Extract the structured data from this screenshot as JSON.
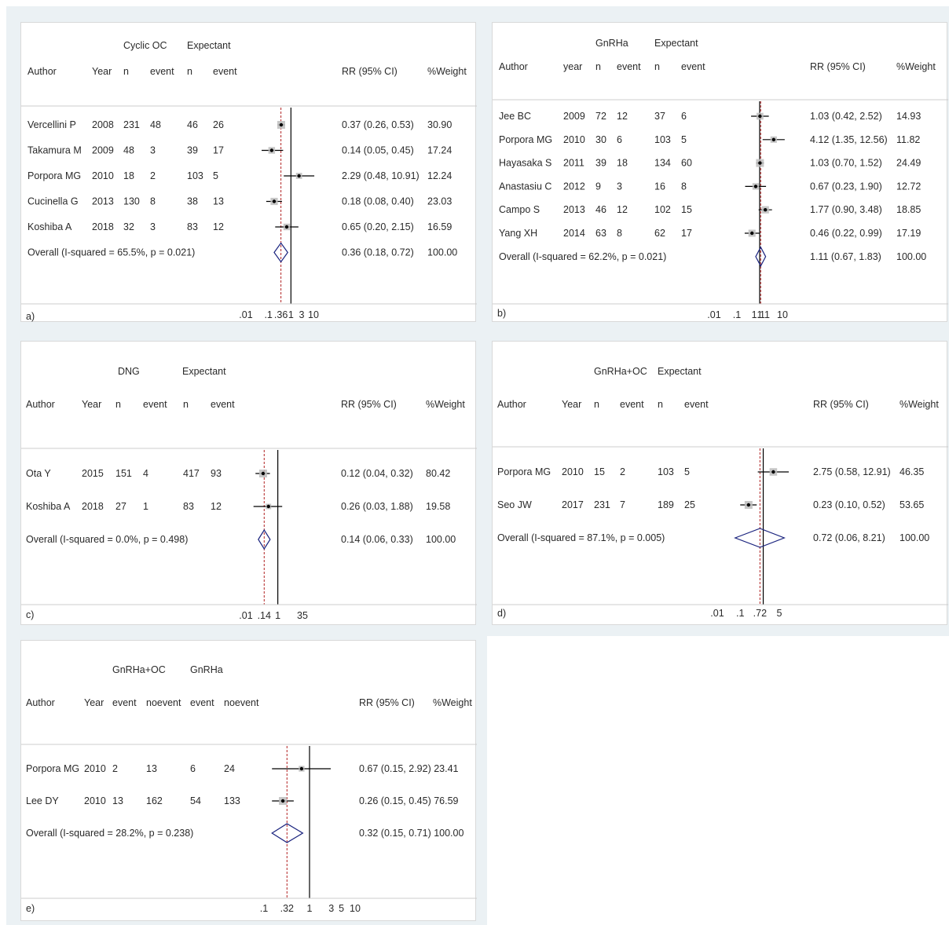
{
  "colors": {
    "background": "#ebf1f4",
    "diamond": "#1a237e",
    "overall_line": "#b22222",
    "null_line": "#000000",
    "marker_box": "#bdbdbd"
  },
  "chart_data": [
    {
      "type": "forest",
      "panel_label": "a)",
      "group_labels": [
        "Cyclic OC",
        "Expectant"
      ],
      "columns": [
        "Author",
        "Year",
        "n",
        "event",
        "n",
        "event",
        "RR (95% CI)",
        "%Weight"
      ],
      "rows": [
        {
          "cells": [
            "Vercellini P",
            "2008",
            "231",
            "48",
            "46",
            "26"
          ],
          "ci_label": "0.37 (0.26, 0.53)",
          "weight_label": "30.90",
          "rr": 0.37,
          "lo": 0.26,
          "hi": 0.53,
          "weight": 30.9
        },
        {
          "cells": [
            "Takamura M",
            "2009",
            "48",
            "3",
            "39",
            "17"
          ],
          "ci_label": "0.14 (0.05, 0.45)",
          "weight_label": "17.24",
          "rr": 0.14,
          "lo": 0.05,
          "hi": 0.45,
          "weight": 17.24
        },
        {
          "cells": [
            "Porpora MG",
            "2010",
            "18",
            "2",
            "103",
            "5"
          ],
          "ci_label": "2.29 (0.48, 10.91)",
          "weight_label": "12.24",
          "rr": 2.29,
          "lo": 0.48,
          "hi": 10.91,
          "weight": 12.24
        },
        {
          "cells": [
            "Cucinella G",
            "2013",
            "130",
            "8",
            "38",
            "13"
          ],
          "ci_label": "0.18 (0.08, 0.40)",
          "weight_label": "23.03",
          "rr": 0.18,
          "lo": 0.08,
          "hi": 0.4,
          "weight": 23.03
        },
        {
          "cells": [
            "Koshiba A",
            "2018",
            "32",
            "3",
            "83",
            "12"
          ],
          "ci_label": "0.65 (0.20, 2.15)",
          "weight_label": "16.59",
          "rr": 0.65,
          "lo": 0.2,
          "hi": 2.15,
          "weight": 16.59
        }
      ],
      "overall": {
        "label": "Overall  (I-squared = 65.5%, p = 0.021)",
        "ci_label": "0.36 (0.18, 0.72)",
        "weight_label": "100.00",
        "rr": 0.36,
        "lo": 0.18,
        "hi": 0.72
      },
      "x_scale": "log",
      "xlim": [
        0.01,
        10
      ],
      "ticks": [
        {
          "value": 0.01,
          "label": ".01"
        },
        {
          "value": 0.1,
          "label": ".1"
        },
        {
          "value": 0.36,
          "label": ".36"
        },
        {
          "value": 1,
          "label": "1"
        },
        {
          "value": 3,
          "label": "3"
        },
        {
          "value": 10,
          "label": "10"
        }
      ]
    },
    {
      "type": "forest",
      "panel_label": "b)",
      "group_labels": [
        "GnRHa",
        "Expectant"
      ],
      "columns": [
        "Author",
        "year",
        "n",
        "event",
        "n",
        "event",
        "RR (95% CI)",
        "%Weight"
      ],
      "rows": [
        {
          "cells": [
            "Jee BC",
            "2009",
            "72",
            "12",
            "37",
            "6"
          ],
          "ci_label": "1.03 (0.42, 2.52)",
          "weight_label": "14.93",
          "rr": 1.03,
          "lo": 0.42,
          "hi": 2.52,
          "weight": 14.93
        },
        {
          "cells": [
            "Porpora MG",
            "2010",
            "30",
            "6",
            "103",
            "5"
          ],
          "ci_label": "4.12 (1.35, 12.56)",
          "weight_label": "11.82",
          "rr": 4.12,
          "lo": 1.35,
          "hi": 12.56,
          "weight": 11.82
        },
        {
          "cells": [
            "Hayasaka S",
            "2011",
            "39",
            "18",
            "134",
            "60"
          ],
          "ci_label": "1.03 (0.70, 1.52)",
          "weight_label": "24.49",
          "rr": 1.03,
          "lo": 0.7,
          "hi": 1.52,
          "weight": 24.49
        },
        {
          "cells": [
            "Anastasiu C",
            "2012",
            "9",
            "3",
            "16",
            "8"
          ],
          "ci_label": "0.67 (0.23, 1.90)",
          "weight_label": "12.72",
          "rr": 0.67,
          "lo": 0.23,
          "hi": 1.9,
          "weight": 12.72
        },
        {
          "cells": [
            "Campo S",
            "2013",
            "46",
            "12",
            "102",
            "15"
          ],
          "ci_label": "1.77 (0.90, 3.48)",
          "weight_label": "18.85",
          "rr": 1.77,
          "lo": 0.9,
          "hi": 3.48,
          "weight": 18.85
        },
        {
          "cells": [
            "Yang XH",
            "2014",
            "63",
            "8",
            "62",
            "17"
          ],
          "ci_label": "0.46 (0.22, 0.99)",
          "weight_label": "17.19",
          "rr": 0.46,
          "lo": 0.22,
          "hi": 0.99,
          "weight": 17.19
        }
      ],
      "overall": {
        "label": "Overall  (I-squared = 62.2%, p = 0.021)",
        "ci_label": "1.11 (0.67, 1.83)",
        "weight_label": "100.00",
        "rr": 1.11,
        "lo": 0.67,
        "hi": 1.83
      },
      "x_scale": "log",
      "xlim": [
        0.01,
        10
      ],
      "ticks": [
        {
          "value": 0.01,
          "label": ".01"
        },
        {
          "value": 0.1,
          "label": ".1"
        },
        {
          "value": 1,
          "label": "1"
        },
        {
          "value": 1.11,
          "label": "1.11"
        },
        {
          "value": 10,
          "label": "10"
        }
      ]
    },
    {
      "type": "forest",
      "panel_label": "c)",
      "group_labels": [
        "DNG",
        "Expectant"
      ],
      "columns": [
        "Author",
        "Year",
        "n",
        "event",
        "n",
        "event",
        "RR (95% CI)",
        "%Weight"
      ],
      "rows": [
        {
          "cells": [
            "Ota Y",
            "2015",
            "151",
            "4",
            "417",
            "93"
          ],
          "ci_label": "0.12 (0.04, 0.32)",
          "weight_label": "80.42",
          "rr": 0.12,
          "lo": 0.04,
          "hi": 0.32,
          "weight": 80.42
        },
        {
          "cells": [
            "Koshiba A",
            "2018",
            "27",
            "1",
            "83",
            "12"
          ],
          "ci_label": "0.26 (0.03, 1.88)",
          "weight_label": "19.58",
          "rr": 0.26,
          "lo": 0.03,
          "hi": 1.88,
          "weight": 19.58
        }
      ],
      "overall": {
        "label": "Overall  (I-squared = 0.0%, p = 0.498)",
        "ci_label": "0.14 (0.06, 0.33)",
        "weight_label": "100.00",
        "rr": 0.14,
        "lo": 0.06,
        "hi": 0.33
      },
      "x_scale": "log",
      "xlim": [
        0.01,
        35
      ],
      "ticks": [
        {
          "value": 0.01,
          "label": ".01"
        },
        {
          "value": 0.14,
          "label": ".14"
        },
        {
          "value": 1,
          "label": "1"
        },
        {
          "value": 35,
          "label": "35"
        }
      ]
    },
    {
      "type": "forest",
      "panel_label": "d)",
      "group_labels": [
        "GnRHa+OC",
        "Expectant"
      ],
      "columns": [
        "Author",
        "Year",
        "n",
        "event",
        "n",
        "event",
        "RR (95% CI)",
        "%Weight"
      ],
      "rows": [
        {
          "cells": [
            "Porpora MG",
            "2010",
            "15",
            "2",
            "103",
            "5"
          ],
          "ci_label": "2.75 (0.58, 12.91)",
          "weight_label": "46.35",
          "rr": 2.75,
          "lo": 0.58,
          "hi": 12.91,
          "weight": 46.35
        },
        {
          "cells": [
            "Seo JW",
            "2017",
            "231",
            "7",
            "189",
            "25"
          ],
          "ci_label": "0.23 (0.10, 0.52)",
          "weight_label": "53.65",
          "rr": 0.23,
          "lo": 0.1,
          "hi": 0.52,
          "weight": 53.65
        }
      ],
      "overall": {
        "label": "Overall  (I-squared = 87.1%, p = 0.005)",
        "ci_label": "0.72 (0.06, 8.21)",
        "weight_label": "100.00",
        "rr": 0.72,
        "lo": 0.06,
        "hi": 8.21
      },
      "x_scale": "log",
      "xlim": [
        0.01,
        5
      ],
      "ticks": [
        {
          "value": 0.01,
          "label": ".01"
        },
        {
          "value": 0.1,
          "label": ".1"
        },
        {
          "value": 0.72,
          "label": ".72"
        },
        {
          "value": 5,
          "label": "5"
        }
      ]
    },
    {
      "type": "forest",
      "panel_label": "e)",
      "group_labels": [
        "GnRHa+OC",
        "GnRHa"
      ],
      "columns": [
        "Author",
        "Year",
        "event",
        "noevent",
        "event",
        "noevent",
        "RR (95% CI)",
        "%Weight"
      ],
      "rows": [
        {
          "cells": [
            "Porpora MG",
            "2010",
            "2",
            "13",
            "6",
            "24"
          ],
          "ci_label": "0.67 (0.15, 2.92) 23.41",
          "weight_label": "",
          "rr": 0.67,
          "lo": 0.15,
          "hi": 2.92,
          "weight": 23.41
        },
        {
          "cells": [
            "Lee DY",
            "2010",
            "13",
            "162",
            "54",
            "133"
          ],
          "ci_label": "0.26 (0.15, 0.45) 76.59",
          "weight_label": "",
          "rr": 0.26,
          "lo": 0.15,
          "hi": 0.45,
          "weight": 76.59
        }
      ],
      "overall": {
        "label": "Overall  (I-squared = 28.2%, p = 0.238)",
        "ci_label": "0.32 (0.15, 0.71) 100.00",
        "weight_label": "",
        "rr": 0.32,
        "lo": 0.15,
        "hi": 0.71
      },
      "x_scale": "log",
      "xlim": [
        0.1,
        10
      ],
      "ticks": [
        {
          "value": 0.1,
          "label": ".1"
        },
        {
          "value": 0.32,
          "label": ".32"
        },
        {
          "value": 1,
          "label": "1"
        },
        {
          "value": 3,
          "label": "3"
        },
        {
          "value": 5,
          "label": "5"
        },
        {
          "value": 10,
          "label": "10"
        }
      ]
    }
  ]
}
